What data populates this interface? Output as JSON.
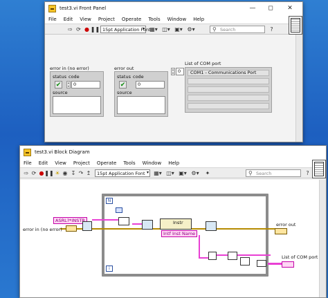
{
  "front_panel": {
    "title": "test3.vi Front Panel",
    "menu": [
      "File",
      "Edit",
      "View",
      "Project",
      "Operate",
      "Tools",
      "Window",
      "Help"
    ],
    "font_selector": "15pt Application Font",
    "search_placeholder": "Search",
    "question": "?",
    "error_in": {
      "label": "error in (no error)",
      "status_label": "status",
      "code_label": "code",
      "code_value": "0",
      "source_label": "source"
    },
    "error_out": {
      "label": "error out",
      "status_label": "status",
      "code_label": "code",
      "code_value": "0",
      "source_label": "source"
    },
    "com_list": {
      "label": "List of COM port",
      "index_value": "0",
      "items": [
        "COM1 - Communications Port",
        "",
        "",
        "",
        ""
      ]
    }
  },
  "block_diagram": {
    "title": "test3.vi Block Diagram",
    "menu": [
      "File",
      "Edit",
      "View",
      "Project",
      "Operate",
      "Tools",
      "Window",
      "Help"
    ],
    "font_selector": "15pt Application Font",
    "search_placeholder": "Search",
    "question": "?",
    "string_constant": "ASRL?*INSTR",
    "error_in_label": "error in (no error)",
    "error_out_label": "error out",
    "com_list_label": "List of COM port",
    "instr_node_label": "Instr",
    "instr_property": "Intf Inst Name",
    "loop_index": "i",
    "n_label": "N"
  },
  "colors": {
    "desktop": "#1d5fc0",
    "string_wire": "#e93fd4",
    "error_wire": "#b58a00",
    "status_ok": "#0a8a0a"
  }
}
